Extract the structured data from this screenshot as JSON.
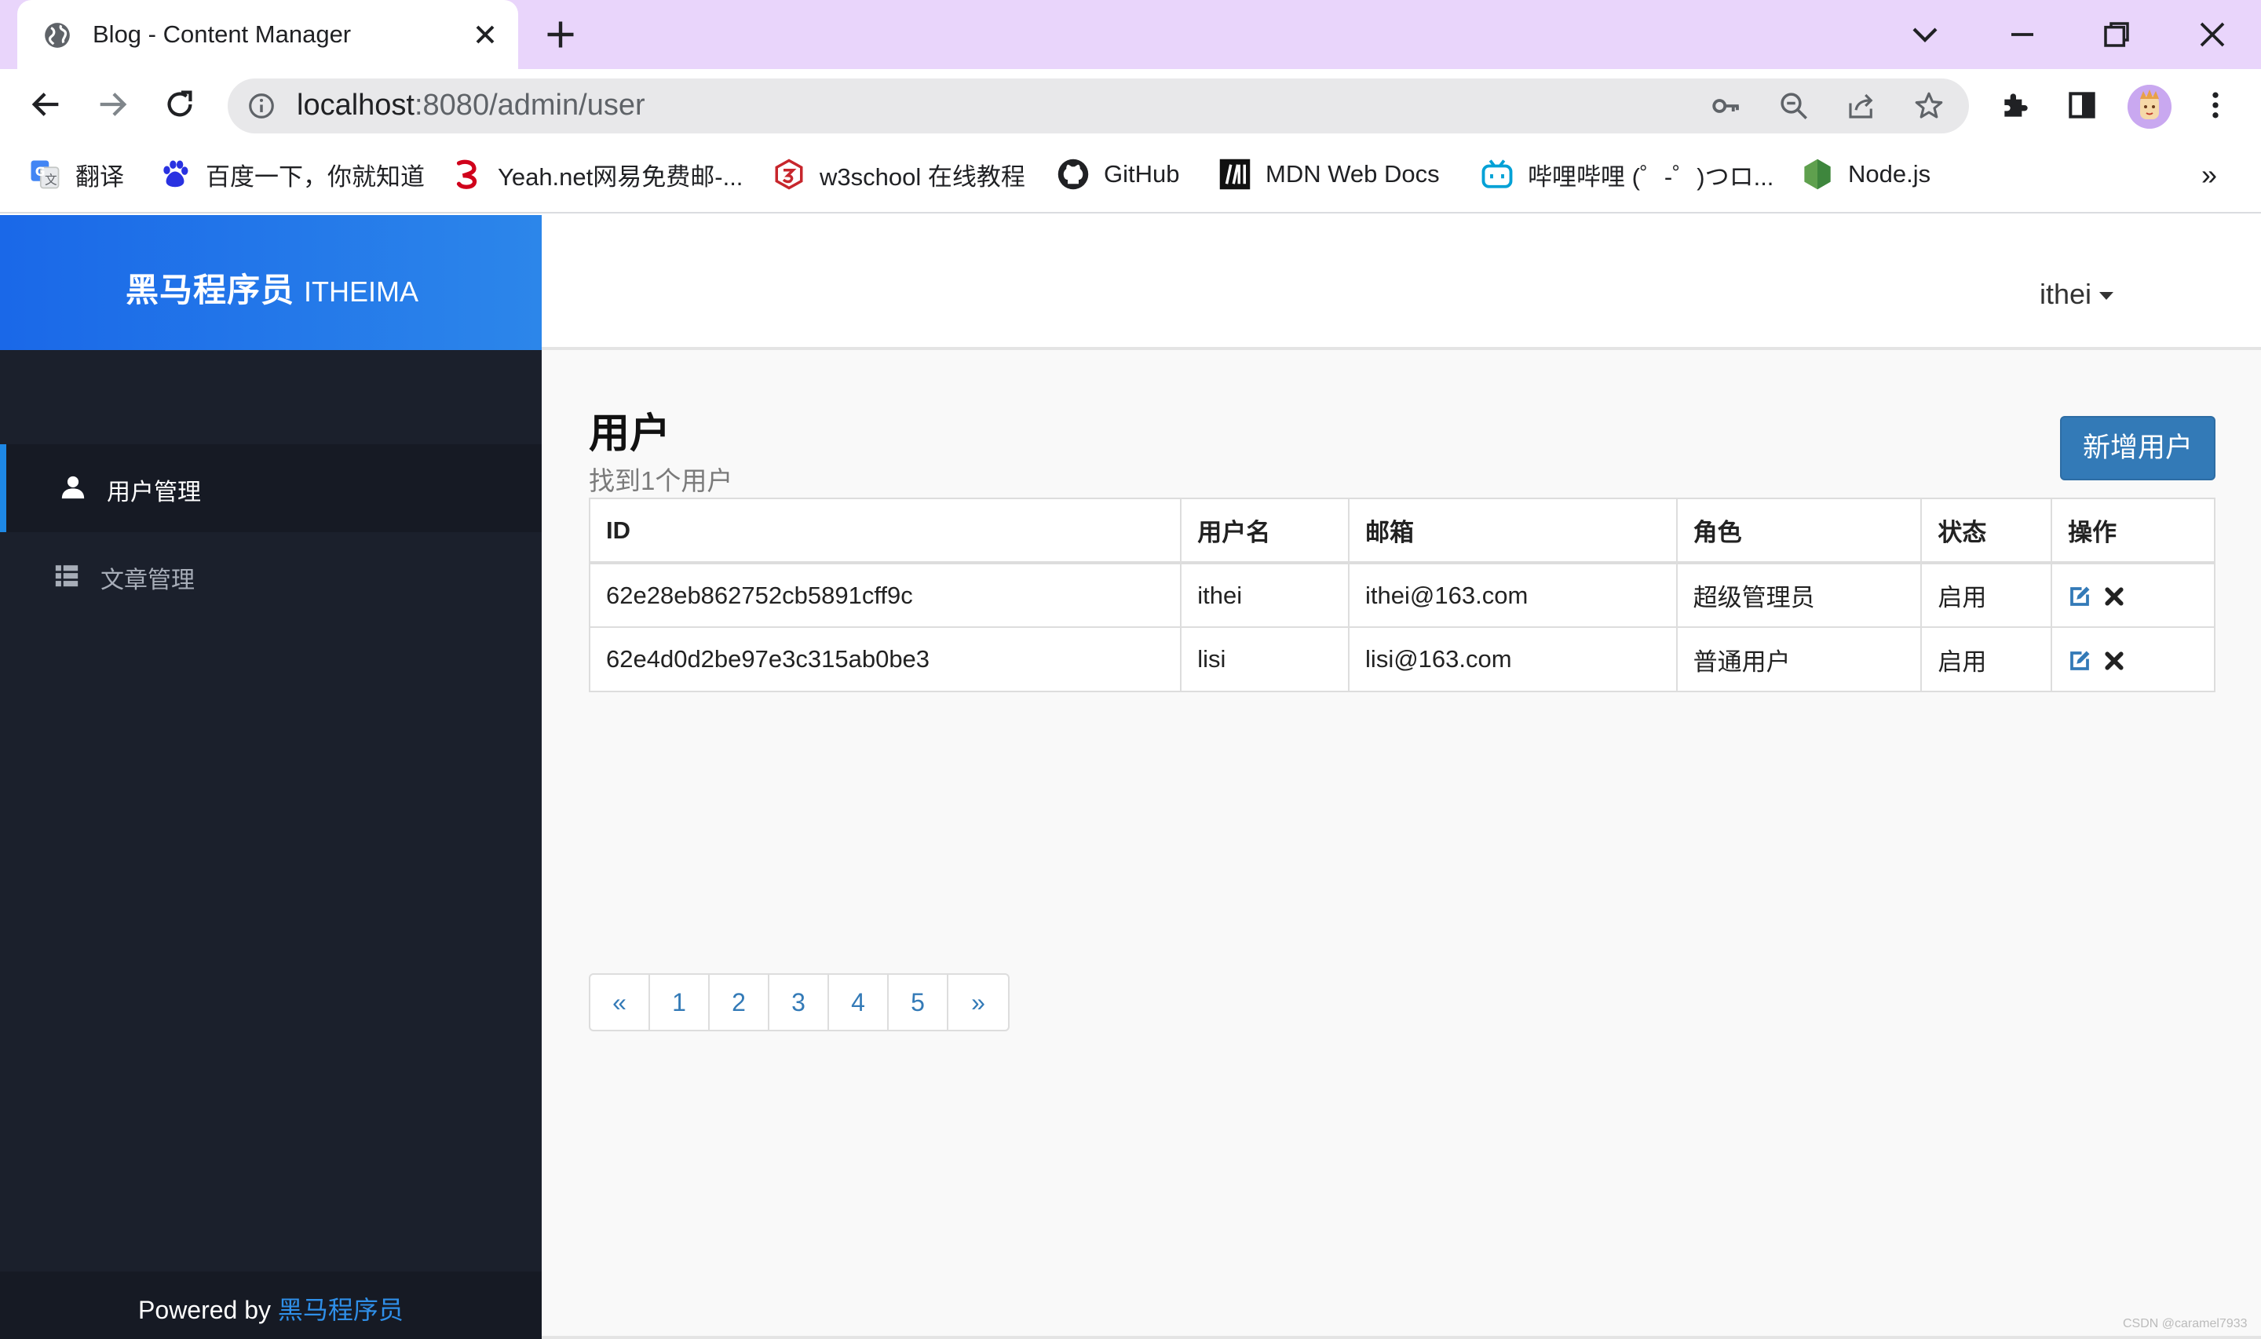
{
  "browser": {
    "tab_title": "Blog - Content Manager",
    "url_host": "localhost",
    "url_rest": ":8080/admin/user",
    "bookmarks": [
      {
        "label": "翻译",
        "icon": "google-translate-icon"
      },
      {
        "label": "百度一下，你就知道",
        "icon": "baidu-icon"
      },
      {
        "label": "Yeah.net网易免费邮-...",
        "icon": "yeah-net-icon"
      },
      {
        "label": "w3school 在线教程",
        "icon": "w3school-icon"
      },
      {
        "label": "GitHub",
        "icon": "github-icon"
      },
      {
        "label": "MDN Web Docs",
        "icon": "mdn-icon"
      },
      {
        "label": "哔哩哔哩 (゜-゜)つロ...",
        "icon": "bilibili-icon"
      },
      {
        "label": "Node.js",
        "icon": "nodejs-icon"
      }
    ],
    "more": "»"
  },
  "brand": {
    "cn": "黑马程序员",
    "en": "ITHEIMA"
  },
  "sidebar": {
    "items": [
      {
        "label": "用户管理",
        "icon": "user-icon",
        "active": true
      },
      {
        "label": "文章管理",
        "icon": "list-icon",
        "active": false
      }
    ],
    "footer_prefix": "Powered by ",
    "footer_link": "黑马程序员"
  },
  "header": {
    "username": "ithei"
  },
  "page": {
    "title": "用户",
    "subtitle": "找到1个用户",
    "add_button": "新增用户"
  },
  "table": {
    "columns": [
      "ID",
      "用户名",
      "邮箱",
      "角色",
      "状态",
      "操作"
    ],
    "rows": [
      {
        "id": "62e28eb862752cb5891cff9c",
        "username": "ithei",
        "email": "ithei@163.com",
        "role": "超级管理员",
        "status": "启用"
      },
      {
        "id": "62e4d0d2be97e3c315ab0be3",
        "username": "lisi",
        "email": "lisi@163.com",
        "role": "普通用户",
        "status": "启用"
      }
    ]
  },
  "pagination": [
    "«",
    "1",
    "2",
    "3",
    "4",
    "5",
    "»"
  ],
  "watermark": "CSDN @caramel7933",
  "colors": {
    "tabstrip": "#e9d5fb",
    "sidebar": "#1b202c",
    "brand_start": "#1a68e8",
    "brand_end": "#2c86ea",
    "primary": "#337ab7",
    "active_bar": "#1e88e5"
  }
}
